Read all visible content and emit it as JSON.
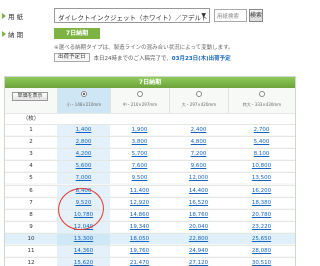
{
  "paper_row": {
    "label": "用 紙",
    "selected_paper": "ダイレクトインクジェット（ホワイト）／アデルト",
    "search_placeholder": "用紙検索",
    "search_button": "検索"
  },
  "delivery_row": {
    "label": "納 期",
    "badge": "7日納期"
  },
  "note_text": "※選べる納期タイプは、製造ラインの混み合い状況によって変動します。",
  "ship_day": {
    "button": "出荷予定日",
    "note_prefix": "本日24時までのご入稿完了で、",
    "note_date": "03月23日(木)出荷予定"
  },
  "table": {
    "header_title": "7日納期",
    "show_all_button": "単価を表示",
    "qty_header": "（枚）",
    "size_columns": [
      {
        "size": "小・148×210mm"
      },
      {
        "size": "中・210×297mm"
      },
      {
        "size": "大・297×420mm"
      },
      {
        "size": "特大・333×430mm"
      }
    ],
    "rows": [
      {
        "qty": "1",
        "prices": [
          "1,400",
          "1,900",
          "2,400",
          "2,700"
        ]
      },
      {
        "qty": "2",
        "prices": [
          "2,800",
          "3,800",
          "4,800",
          "5,400"
        ]
      },
      {
        "qty": "3",
        "prices": [
          "4,200",
          "5,700",
          "7,200",
          "8,100"
        ]
      },
      {
        "qty": "4",
        "prices": [
          "5,600",
          "7,600",
          "9,600",
          "10,800"
        ]
      },
      {
        "qty": "5",
        "prices": [
          "7,000",
          "9,500",
          "12,000",
          "13,500"
        ]
      },
      {
        "qty": "6",
        "prices": [
          "8,400",
          "11,400",
          "14,400",
          "16,200"
        ]
      },
      {
        "qty": "7",
        "prices": [
          "9,520",
          "12,920",
          "16,520",
          "18,380"
        ]
      },
      {
        "qty": "8",
        "prices": [
          "10,780",
          "14,860",
          "18,760",
          "20,780"
        ]
      },
      {
        "qty": "9",
        "prices": [
          "12,040",
          "19,340",
          "20,040",
          "23,220"
        ]
      },
      {
        "qty": "10",
        "prices": [
          "13,300",
          "18,050",
          "22,800",
          "25,650"
        ]
      },
      {
        "qty": "11",
        "prices": [
          "14,360",
          "19,760",
          "24,940",
          "28,080"
        ]
      },
      {
        "qty": "12",
        "prices": [
          "15,620",
          "21,470",
          "27,120",
          "30,510"
        ]
      }
    ],
    "highlighted_row": "10"
  },
  "colors": {
    "accent_green": "#7cb342",
    "link_blue": "#1565c0",
    "selected_column": "#cfe6f5",
    "annotation_red": "#e53935"
  }
}
